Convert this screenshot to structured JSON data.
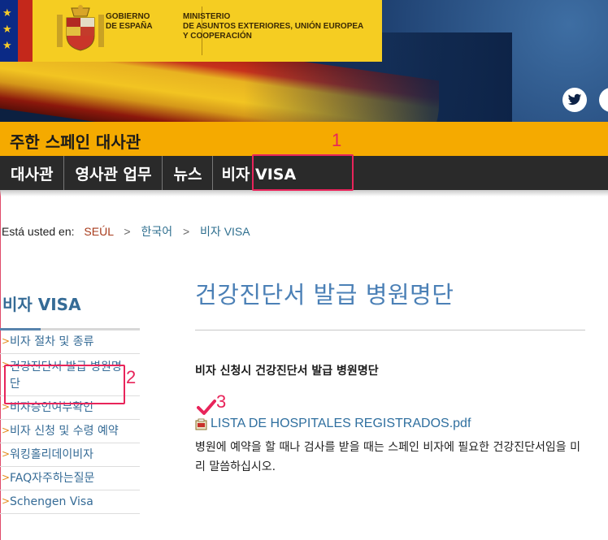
{
  "header": {
    "gov_line1": "GOBIERNO",
    "gov_line2": "DE ESPAÑA",
    "ministry_line1": "MINISTERIO",
    "ministry_line2": "DE ASUNTOS EXTERIORES, UNIÓN EUROPEA",
    "ministry_line3": "Y COOPERACIÓN",
    "social_icons": [
      "twitter-icon",
      "social-icon"
    ]
  },
  "site_title": "주한 스페인 대사관",
  "nav": {
    "items": [
      {
        "label": "대사관"
      },
      {
        "label": "영사관 업무"
      },
      {
        "label": "뉴스"
      },
      {
        "label": "비자 VISA"
      }
    ]
  },
  "breadcrumb": {
    "prefix": "Está usted en:",
    "items": [
      "SEÚL",
      "한국어",
      "비자 VISA"
    ],
    "separator": ">"
  },
  "sidebar": {
    "title": "비자 VISA",
    "items": [
      {
        "label": "비자 절차 및 종류"
      },
      {
        "label": "건강진단서 발급 병원명단"
      },
      {
        "label": "비자승인여부확인"
      },
      {
        "label": "비자 신청 및 수령 예약"
      },
      {
        "label": "워킹홀리데이비자"
      },
      {
        "label": "FAQ자주하는질문"
      },
      {
        "label": "Schengen Visa"
      }
    ]
  },
  "content": {
    "title": "건강진단서 발급 병원명단",
    "subtitle": "비자 신청시 건강진단서 발급 병원명단",
    "pdf_link": "LISTA DE HOSPITALES REGISTRADOS.pdf",
    "description": "병원에 예약을 할 때나 검사를 받을 때는 스페인 비자에 필요한 건강진단서임을 미리 말씀하십시오."
  },
  "annotations": {
    "n1": "1",
    "n2": "2",
    "n3": "3",
    "color": "#e8245a"
  },
  "colors": {
    "brand_yellow": "#f5cd22",
    "title_bar": "#f5aa00",
    "nav_bg": "#2a2a2a",
    "link_blue": "#356b96"
  }
}
